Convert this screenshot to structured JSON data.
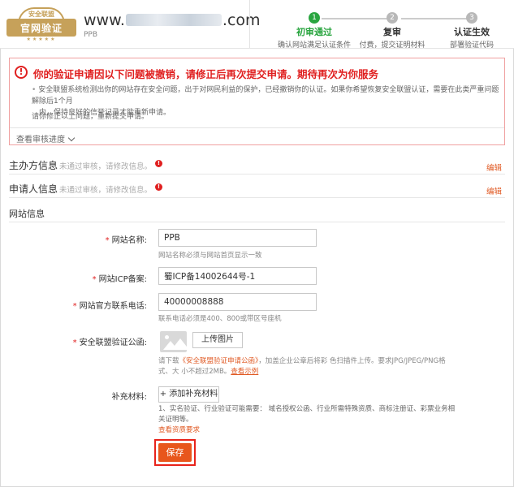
{
  "header": {
    "badge_top": "安全联盟",
    "badge_main": "官网验证",
    "badge_stars": "★★★★★",
    "domain_prefix": "www.",
    "domain_suffix": ".com",
    "site_short": "PPB"
  },
  "steps": [
    {
      "num": "1",
      "title": "初审通过",
      "desc": "确认网站满足认证条件",
      "active": true
    },
    {
      "num": "2",
      "title": "复审",
      "desc": "付费，提交证明材料",
      "active": false
    },
    {
      "num": "3",
      "title": "认证生效",
      "desc": "部署验证代码",
      "active": false
    }
  ],
  "alert": {
    "icon": "!",
    "title": "你的验证申请因以下问题被撤销，请修正后再次提交申请。期待再次为你服务",
    "body_line1": "安全联盟系统检测出你的网站存在安全问题，出于对网民利益的保护，已经撤销你的认证。如果你希望恢复安全联盟认证，需要在此类严重问题解除后1个月",
    "body_line2": "内，保持良好的信誉记录才能重新申请。",
    "note": "请你修正以上问题，重新提交申请。",
    "progress_link": "查看审核进度"
  },
  "sections": {
    "sponsor": {
      "title": "主办方信息",
      "note": "未通过审核，请修改信息。",
      "edit": "编辑"
    },
    "applicant": {
      "title": "申请人信息",
      "note": "未通过审核，请修改信息。",
      "edit": "编辑"
    },
    "website": {
      "title": "网站信息"
    }
  },
  "form": {
    "required_mark": "*",
    "site_name_label": "网站名称:",
    "site_name_value": "PPB",
    "site_name_help": "网站名称必须与网站首页显示一致",
    "icp_label": "网站ICP备案:",
    "icp_value": "蜀ICP备14002644号-1",
    "phone_label": "网站官方联系电话:",
    "phone_value": "40000008888",
    "phone_help": "联系电话必须是400、800或带区号座机",
    "letter_label": "安全联盟验证公函:",
    "upload_button": "上传图片",
    "upload_help_prefix": "请下载",
    "upload_help_doc": "《安全联盟验证申请公函》",
    "upload_help_mid": "，加盖企业公章后将彩 色扫描件上传。要求JPG/JPEG/PNG格式、大 小不超过2MB。",
    "upload_help_link": "查看示例",
    "supp_label": "补充材料:",
    "add_button": "+ 添加补充材料",
    "supp_help": "1、实名验证、行业验证可能需要： 域名授权公函、行业所需特殊资质、商标注册证、彩票业务相关证明等。",
    "supp_link": "查看资质要求",
    "save_button": "保存"
  }
}
